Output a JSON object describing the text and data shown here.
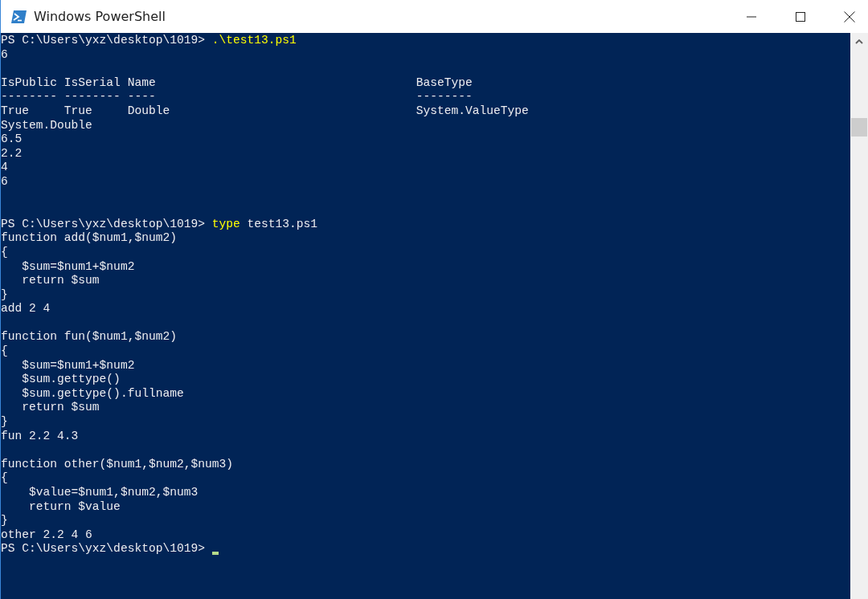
{
  "window": {
    "title": "Windows PowerShell"
  },
  "console": {
    "lines": [
      {
        "kind": "prompt",
        "prompt": "PS C:\\Users\\yxz\\desktop\\1019> ",
        "command": ".\\test13.ps1",
        "cursor": false
      },
      {
        "kind": "output",
        "text": "6"
      },
      {
        "kind": "blank"
      },
      {
        "kind": "output",
        "text": "IsPublic IsSerial Name                                     BaseType"
      },
      {
        "kind": "output",
        "text": "-------- -------- ----                                     --------"
      },
      {
        "kind": "output",
        "text": "True     True     Double                                   System.ValueType"
      },
      {
        "kind": "output",
        "text": "System.Double"
      },
      {
        "kind": "output",
        "text": "6.5"
      },
      {
        "kind": "output",
        "text": "2.2"
      },
      {
        "kind": "output",
        "text": "4"
      },
      {
        "kind": "output",
        "text": "6"
      },
      {
        "kind": "blank"
      },
      {
        "kind": "blank"
      },
      {
        "kind": "prompt",
        "prompt": "PS C:\\Users\\yxz\\desktop\\1019> ",
        "command": "type",
        "args": "test13.ps1",
        "cursor": false
      },
      {
        "kind": "output",
        "text": "function add($num1,$num2)"
      },
      {
        "kind": "output",
        "text": "{"
      },
      {
        "kind": "output",
        "text": "   $sum=$num1+$num2"
      },
      {
        "kind": "output",
        "text": "   return $sum"
      },
      {
        "kind": "output",
        "text": "}"
      },
      {
        "kind": "output",
        "text": "add 2 4"
      },
      {
        "kind": "blank"
      },
      {
        "kind": "output",
        "text": "function fun($num1,$num2)"
      },
      {
        "kind": "output",
        "text": "{"
      },
      {
        "kind": "output",
        "text": "   $sum=$num1+$num2"
      },
      {
        "kind": "output",
        "text": "   $sum.gettype()"
      },
      {
        "kind": "output",
        "text": "   $sum.gettype().fullname"
      },
      {
        "kind": "output",
        "text": "   return $sum"
      },
      {
        "kind": "output",
        "text": "}"
      },
      {
        "kind": "output",
        "text": "fun 2.2 4.3"
      },
      {
        "kind": "blank"
      },
      {
        "kind": "output",
        "text": "function other($num1,$num2,$num3)"
      },
      {
        "kind": "output",
        "text": "{"
      },
      {
        "kind": "output",
        "text": "    $value=$num1,$num2,$num3"
      },
      {
        "kind": "output",
        "text": "    return $value"
      },
      {
        "kind": "output",
        "text": "}"
      },
      {
        "kind": "output",
        "text": "other 2.2 4 6"
      },
      {
        "kind": "prompt",
        "prompt": "PS C:\\Users\\yxz\\desktop\\1019> ",
        "cursor": true
      }
    ]
  }
}
